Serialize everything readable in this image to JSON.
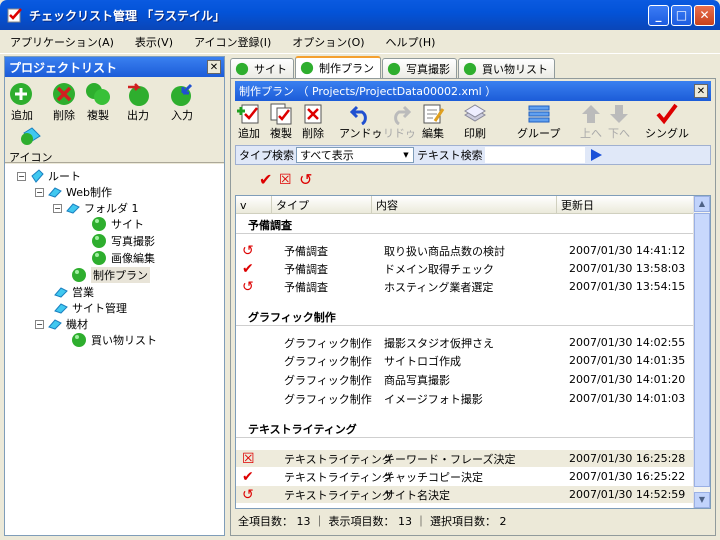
{
  "window": {
    "title": "チェックリスト管理 「ラステイル」"
  },
  "menu": [
    "アプリケーション(A)",
    "表示(V)",
    "アイコン登録(I)",
    "オプション(O)",
    "ヘルプ(H)"
  ],
  "left": {
    "title": "プロジェクトリスト",
    "toolbar": {
      "add": "追加",
      "delete": "削除",
      "copy": "複製",
      "export": "出力",
      "import": "入力",
      "icon": "アイコン"
    },
    "tree": {
      "root": "ルート",
      "web": "Web制作",
      "folder1": "フォルダ 1",
      "site": "サイト",
      "photo": "写真撮影",
      "imageedit": "画像編集",
      "plan": "制作プラン",
      "sales": "営業",
      "sitemgmt": "サイト管理",
      "equipment": "機材",
      "shopping": "買い物リスト"
    }
  },
  "tabs": [
    "サイト",
    "制作プラン",
    "写真撮影",
    "買い物リスト"
  ],
  "doc": {
    "title": "制作プラン （ Projects/ProjectData00002.xml ）",
    "toolbar": {
      "add": "追加",
      "copy": "複製",
      "delete": "削除",
      "undo": "アンドゥ",
      "redo": "リドゥ",
      "edit": "編集",
      "print": "印刷",
      "group": "グループ",
      "up": "上へ",
      "down": "下へ",
      "single": "シングル"
    },
    "search": {
      "type_label": "タイプ検索",
      "type_value": "すべて表示",
      "text_label": "テキスト検索"
    },
    "columns": [
      "v",
      "タイプ",
      "内容",
      "更新日"
    ],
    "groups": [
      {
        "name": "予備調査",
        "rows": [
          {
            "icon": "later",
            "type": "予備調査",
            "content": "取り扱い商品点数の検討",
            "date": "2007/01/30 14:41:12"
          },
          {
            "icon": "check",
            "type": "予備調査",
            "content": "ドメイン取得チェック",
            "date": "2007/01/30 13:58:03"
          },
          {
            "icon": "later",
            "type": "予備調査",
            "content": "ホスティング業者選定",
            "date": "2007/01/30 13:54:15"
          }
        ]
      },
      {
        "name": "グラフィック制作",
        "rows": [
          {
            "icon": "",
            "type": "グラフィック制作",
            "content": "撮影スタジオ仮押さえ",
            "date": "2007/01/30 14:02:55"
          },
          {
            "icon": "",
            "type": "グラフィック制作",
            "content": "サイトロゴ作成",
            "date": "2007/01/30 14:01:35"
          },
          {
            "icon": "",
            "type": "グラフィック制作",
            "content": "商品写真撮影",
            "date": "2007/01/30 14:01:20"
          },
          {
            "icon": "",
            "type": "グラフィック制作",
            "content": "イメージフォト撮影",
            "date": "2007/01/30 14:01:03"
          }
        ]
      },
      {
        "name": "テキストライティング",
        "rows": [
          {
            "icon": "cross",
            "type": "テキストライティング",
            "content": "キーワード・フレーズ決定",
            "date": "2007/01/30 16:25:28"
          },
          {
            "icon": "check",
            "type": "テキストライティング",
            "content": "キャッチコピー決定",
            "date": "2007/01/30 16:25:22"
          },
          {
            "icon": "later",
            "type": "テキストライティング",
            "content": "サイト名決定",
            "date": "2007/01/30 14:52:59"
          }
        ]
      }
    ],
    "status": "全項目数： 13 ｜ 表示項目数： 13 ｜ 選択項目数： 2"
  }
}
